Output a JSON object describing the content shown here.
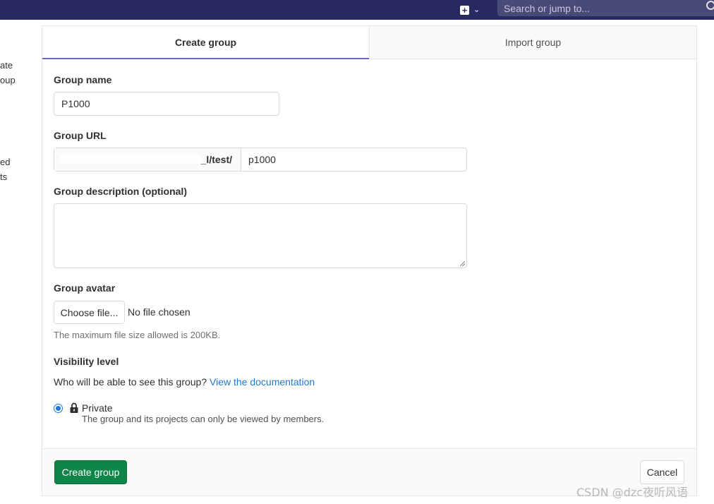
{
  "topbar": {
    "search_placeholder": "Search or jump to...",
    "plus_glyph": "+",
    "chevron_glyph": "⌄"
  },
  "left_sidebar_clipped": [
    "ate",
    "oup",
    "ed",
    "ts"
  ],
  "tabs": [
    {
      "label": "Create group",
      "active": true
    },
    {
      "label": "Import group",
      "active": false
    }
  ],
  "form": {
    "group_name_label": "Group name",
    "group_name_value": "P1000",
    "group_url_label": "Group URL",
    "group_url_prefix": "_l/test/",
    "group_url_path": "p1000",
    "description_label": "Group description (optional)",
    "avatar_label": "Group avatar",
    "choose_file_label": "Choose file...",
    "no_file_text": "No file chosen",
    "max_size_help": "The maximum file size allowed is 200KB.",
    "visibility_label": "Visibility level",
    "visibility_question": "Who will be able to see this group?",
    "visibility_doc_link": "View the documentation",
    "private_label": "Private",
    "private_description": "The group and its projects can only be viewed by members."
  },
  "footer": {
    "create_button": "Create group",
    "cancel_button": "Cancel"
  },
  "watermark": "CSDN @dzc夜听风语",
  "colors": {
    "topbar": "#292961",
    "accent_tab": "#6666c4",
    "primary_button": "#108548",
    "link": "#1f78d1"
  }
}
